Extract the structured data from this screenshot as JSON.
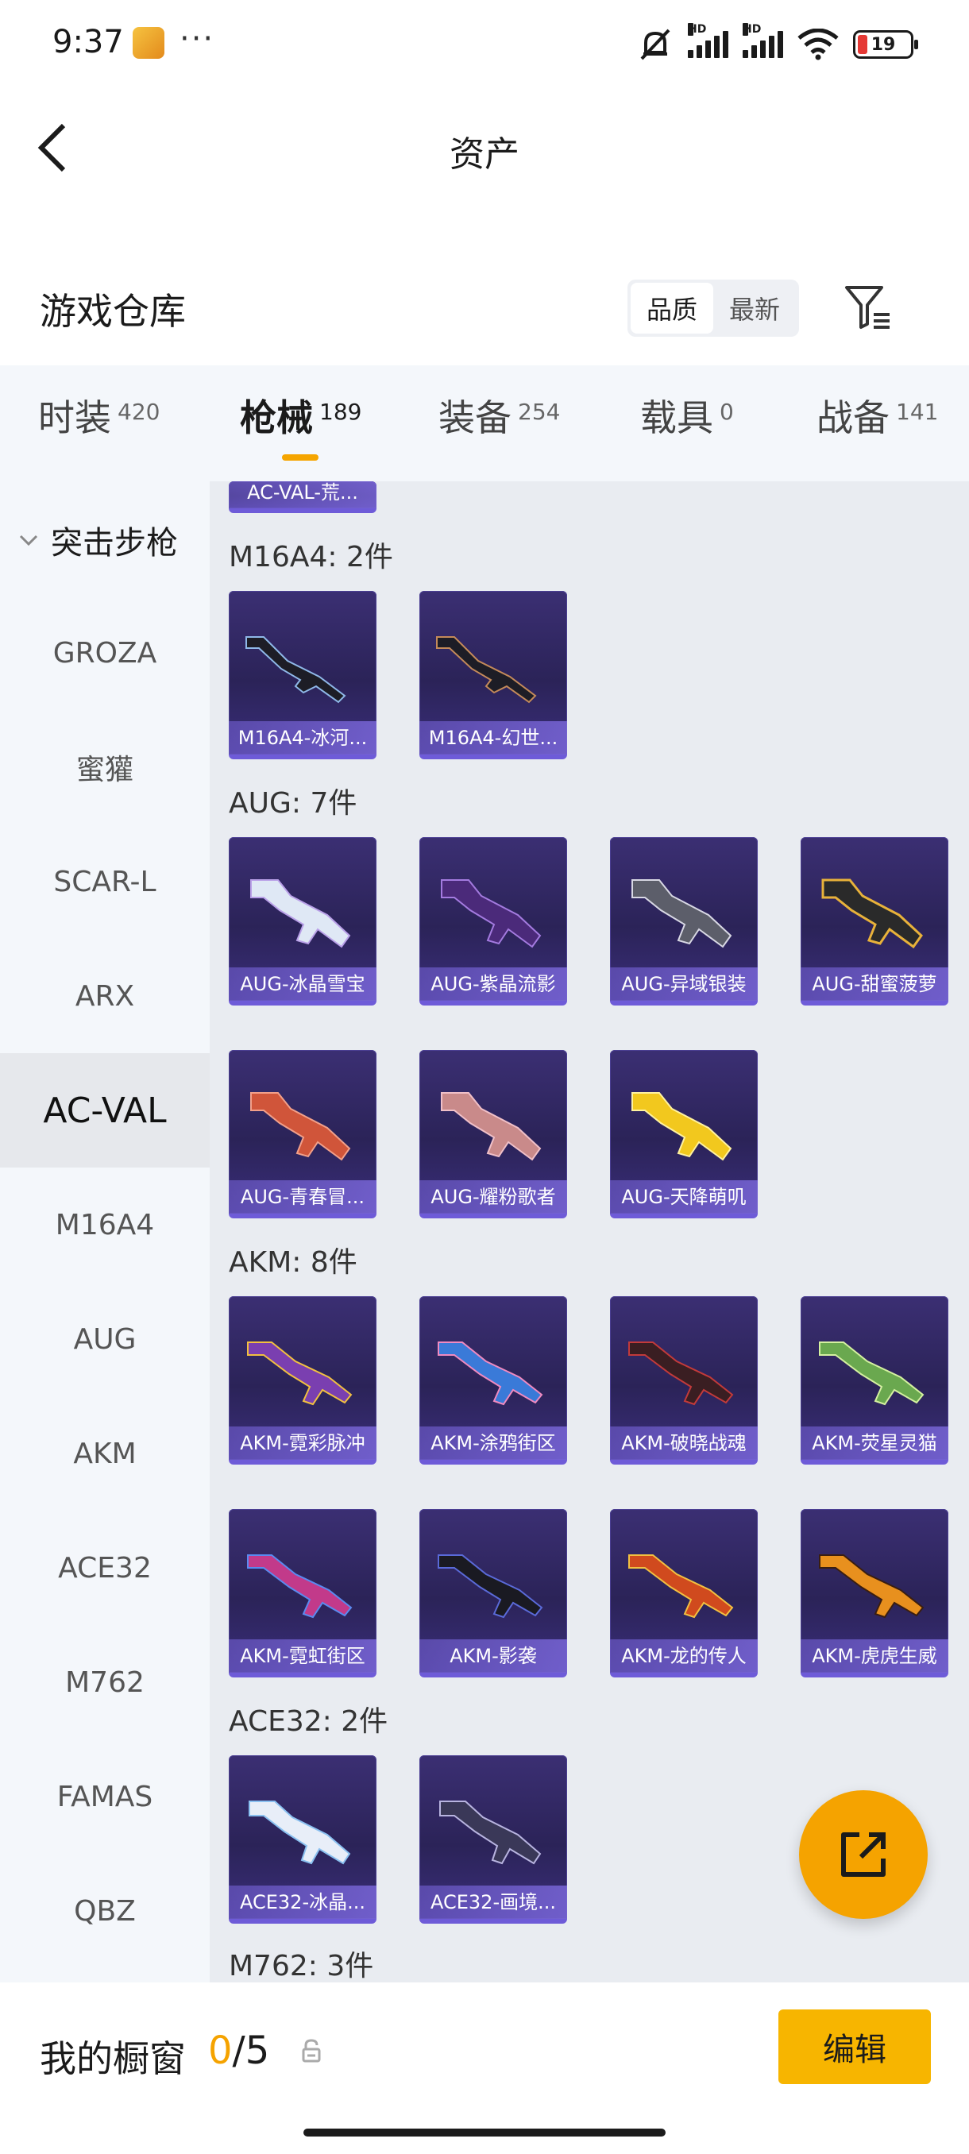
{
  "status_bar": {
    "time": "9:37",
    "dots": "···",
    "battery": "19",
    "hd1": "HD",
    "hd2": "HD",
    "accent_battery": "#e53935"
  },
  "header": {
    "title": "资产",
    "back_icon": "back-arrow-icon"
  },
  "section": {
    "title": "游戏仓库",
    "sort_options": [
      "品质",
      "最新"
    ],
    "sort_selected": "品质",
    "filter_icon": "filter-icon"
  },
  "tabs": [
    {
      "label": "时装",
      "count": "420"
    },
    {
      "label": "枪械",
      "count": "189",
      "active": true
    },
    {
      "label": "装备",
      "count": "254"
    },
    {
      "label": "载具",
      "count": "0"
    },
    {
      "label": "战备",
      "count": "141"
    }
  ],
  "sidebar": {
    "group": "突击步枪",
    "items": [
      "GROZA",
      "蜜獾",
      "SCAR-L",
      "ARX",
      "AC-VAL",
      "M16A4",
      "AUG",
      "AKM",
      "ACE32",
      "M762",
      "FAMAS",
      "QBZ"
    ],
    "selected": "AC-VAL"
  },
  "content": {
    "top_partial_item": "AC-VAL-荒...",
    "groups": [
      {
        "label": "M16A4: 2件",
        "items": [
          "M16A4-冰河...",
          "M16A4-幻世..."
        ]
      },
      {
        "label": "AUG: 7件",
        "items": [
          "AUG-冰晶雪宝",
          "AUG-紫晶流影",
          "AUG-异域银装",
          "AUG-甜蜜菠萝",
          "AUG-青春冒...",
          "AUG-耀粉歌者",
          "AUG-天降萌叽"
        ]
      },
      {
        "label": "AKM: 8件",
        "items": [
          "AKM-霓彩脉冲",
          "AKM-涂鸦街区",
          "AKM-破晓战魂",
          "AKM-荧星灵猫",
          "AKM-霓虹街区",
          "AKM-影袭",
          "AKM-龙的传人",
          "AKM-虎虎生威"
        ]
      },
      {
        "label": "ACE32: 2件",
        "items": [
          "ACE32-冰晶...",
          "ACE32-画境..."
        ]
      },
      {
        "label": "M762: 3件",
        "items": []
      }
    ]
  },
  "fab": {
    "icon": "share-external-icon",
    "color": "#f5a300"
  },
  "bottom": {
    "label": "我的橱窗",
    "current": "0",
    "separator": "/",
    "total": "5",
    "lock_icon": "lock-icon",
    "edit_label": "编辑",
    "accent": "#f7b500"
  }
}
